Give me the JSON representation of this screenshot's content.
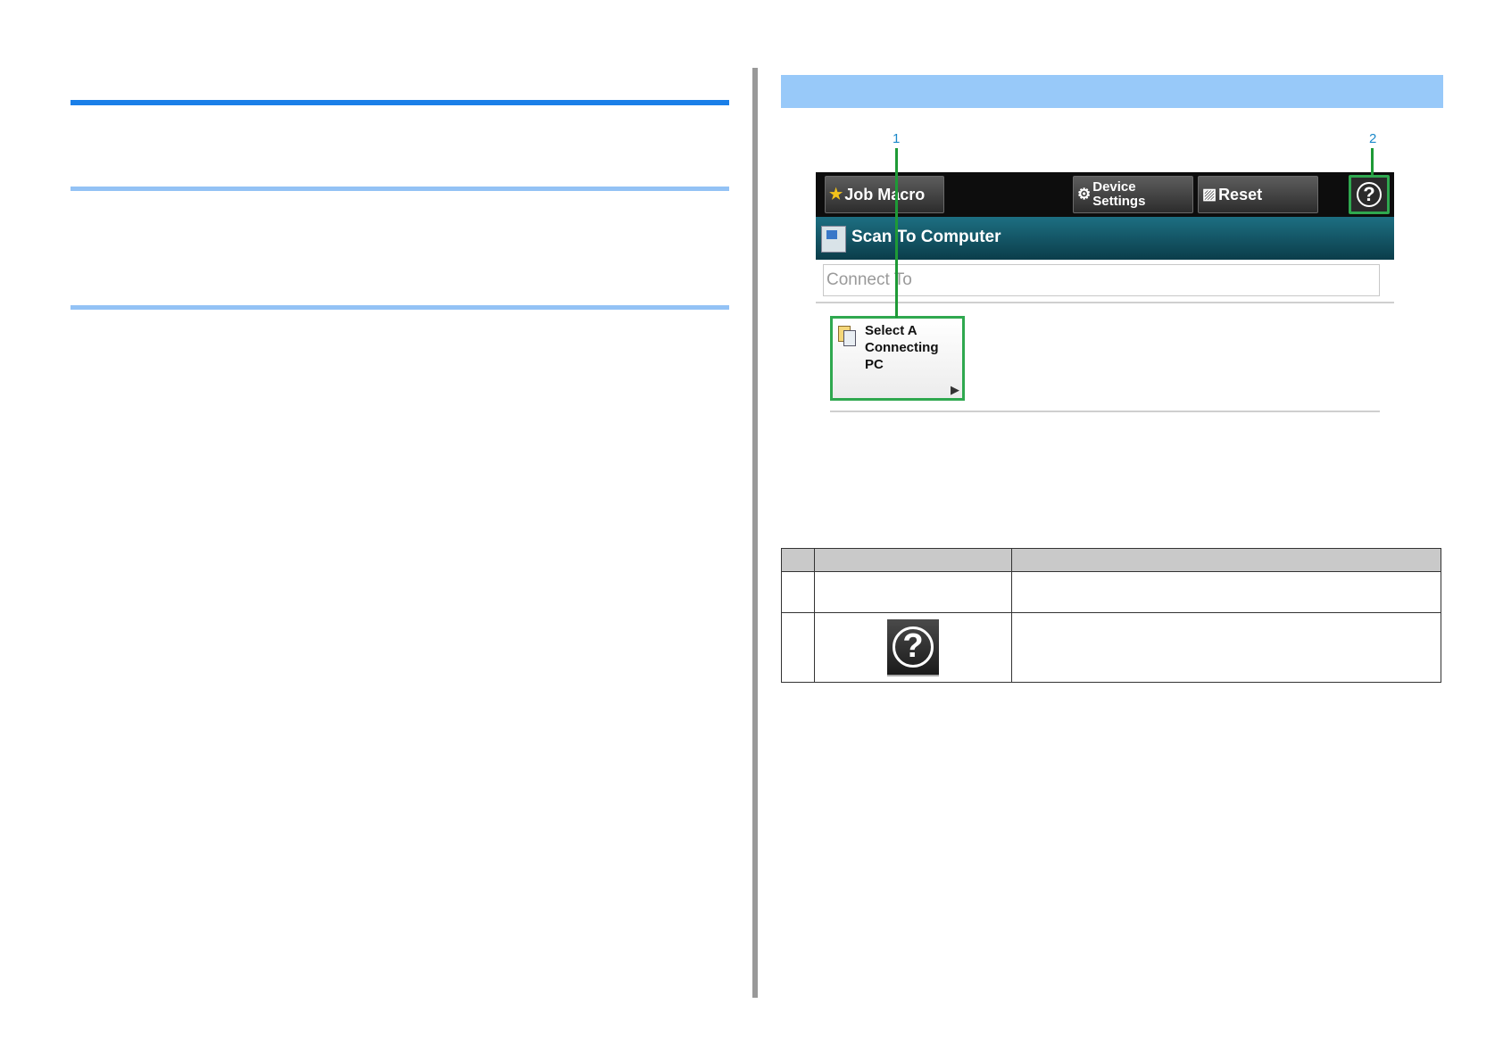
{
  "callouts": {
    "one": "1",
    "two": "2"
  },
  "toolbar": {
    "job_macro_label": "Job Macro",
    "device_settings_line1": "Device",
    "device_settings_line2": "Settings",
    "reset_label": "Reset",
    "help_symbol": "?"
  },
  "screen": {
    "title": "Scan To Computer",
    "connect_to_label": "Connect To",
    "select_tile": {
      "line1": "Select A",
      "line2": "Connecting",
      "line3": "PC",
      "arrow": "▶"
    }
  },
  "table": {
    "rows": [
      {
        "num": "",
        "item": "",
        "description": ""
      },
      {
        "num": "",
        "item_icon": "help-icon",
        "description": ""
      }
    ]
  },
  "colors": {
    "accent_rule": "#1a7fe8",
    "light_rule": "#93c2f5",
    "section_band": "#98c9f9",
    "highlight_green": "#2fa84f",
    "callout_blue": "#1a88c9"
  }
}
